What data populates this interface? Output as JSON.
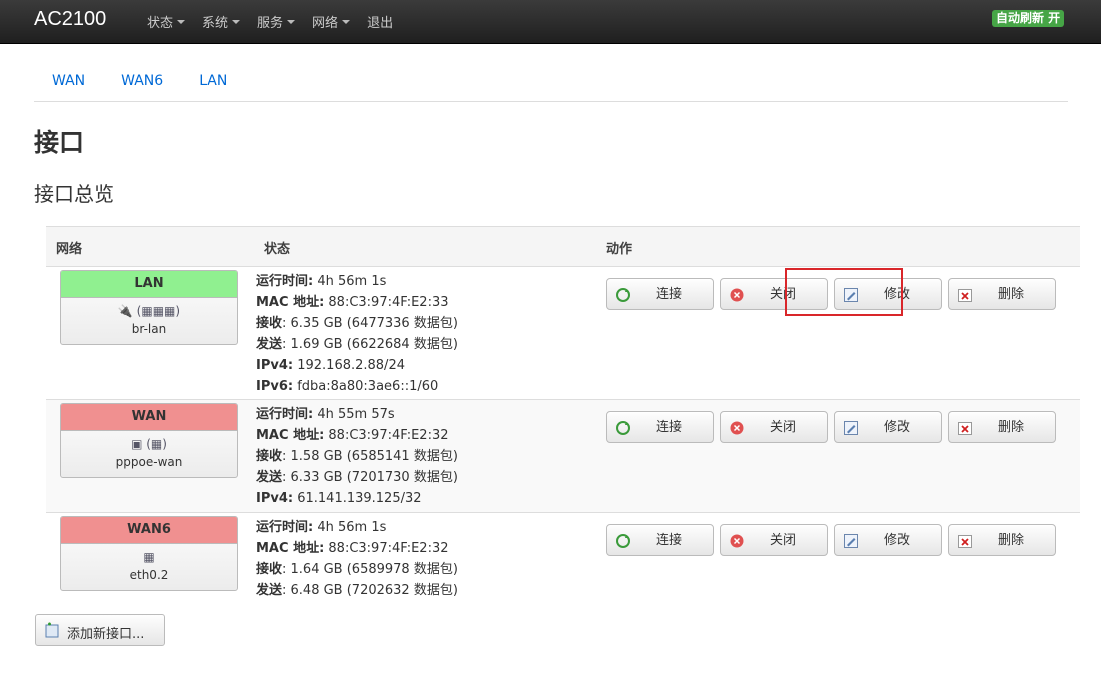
{
  "navbar": {
    "brand": "AC2100",
    "menu": [
      {
        "label": "状态",
        "dropdown": true
      },
      {
        "label": "系统",
        "dropdown": true
      },
      {
        "label": "服务",
        "dropdown": true
      },
      {
        "label": "网络",
        "dropdown": true
      },
      {
        "label": "退出",
        "dropdown": false
      }
    ],
    "autorefresh": "自动刷新 开"
  },
  "tabs": [
    "WAN",
    "WAN6",
    "LAN"
  ],
  "page": {
    "title": "接口",
    "subtitle": "接口总览"
  },
  "table": {
    "headers": {
      "network": "网络",
      "status": "状态",
      "actions": "动作"
    },
    "rows": [
      {
        "name": "LAN",
        "name_color": "#90f090",
        "device": "br-lan",
        "icons": "🔌 (▦▦▦)",
        "status": [
          {
            "k": "运行时间:",
            "v": " 4h 56m 1s"
          },
          {
            "k": "MAC 地址:",
            "v": " 88:C3:97:4F:E2:33"
          },
          {
            "k": "接收",
            "v": ": 6.35 GB (6477336 数据包)"
          },
          {
            "k": "发送",
            "v": ": 1.69 GB (6622684 数据包)"
          },
          {
            "k": "IPv4:",
            "v": " 192.168.2.88/24"
          },
          {
            "k": "IPv6:",
            "v": " fdba:8a80:3ae6::1/60"
          }
        ]
      },
      {
        "name": "WAN",
        "name_color": "#f09090",
        "device": "pppoe-wan",
        "icons": "▣ (▦)",
        "status": [
          {
            "k": "运行时间:",
            "v": " 4h 55m 57s"
          },
          {
            "k": "MAC 地址:",
            "v": " 88:C3:97:4F:E2:32"
          },
          {
            "k": "接收",
            "v": ": 1.58 GB (6585141 数据包)"
          },
          {
            "k": "发送",
            "v": ": 6.33 GB (7201730 数据包)"
          },
          {
            "k": "IPv4:",
            "v": " 61.141.139.125/32"
          }
        ]
      },
      {
        "name": "WAN6",
        "name_color": "#f09090",
        "device": "eth0.2",
        "icons": "▦",
        "status": [
          {
            "k": "运行时间:",
            "v": " 4h 56m 1s"
          },
          {
            "k": "MAC 地址:",
            "v": " 88:C3:97:4F:E2:32"
          },
          {
            "k": "接收",
            "v": ": 1.64 GB (6589978 数据包)"
          },
          {
            "k": "发送",
            "v": ": 6.48 GB (7202632 数据包)"
          }
        ]
      }
    ],
    "actions": [
      {
        "label": "连接",
        "icon": "reconnect-icon"
      },
      {
        "label": "关闭",
        "icon": "shutdown-icon"
      },
      {
        "label": "修改",
        "icon": "edit-icon"
      },
      {
        "label": "删除",
        "icon": "delete-icon"
      }
    ]
  },
  "add_button": "添加新接口..."
}
